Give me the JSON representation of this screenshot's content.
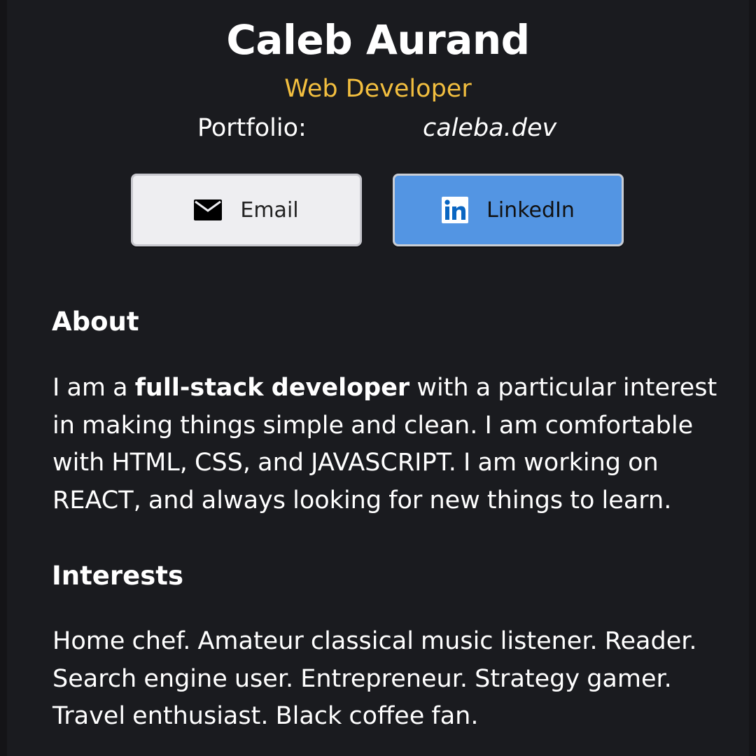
{
  "profile": {
    "name": "Caleb Aurand",
    "role": "Web Developer",
    "portfolio_label": "Portfolio:",
    "portfolio_link": "caleba.dev"
  },
  "buttons": {
    "email": {
      "label": "Email",
      "icon": "envelope-icon"
    },
    "linkedin": {
      "label": "LinkedIn",
      "icon": "linkedin-icon"
    }
  },
  "about": {
    "heading": "About",
    "text_prefix": "I am a ",
    "text_bold": "full-stack developer",
    "text_suffix": " with a particular interest in making things simple and clean. I am comfortable with HTML, CSS, and JAVASCRIPT. I am working on REACT, and always looking for new things to learn."
  },
  "interests": {
    "heading": "Interests",
    "text": "Home chef. Amateur classical music listener. Reader. Search engine user. Entrepreneur. Strategy gamer. Travel enthusiast. Black coffee fan."
  },
  "colors": {
    "background": "#1a1b1f",
    "accent": "#f3bf3f",
    "email_button": "#eeeef1",
    "linkedin_button": "#5395e3"
  }
}
